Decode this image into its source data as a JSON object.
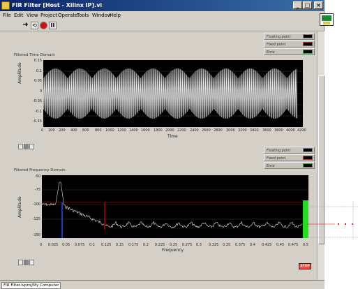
{
  "window": {
    "title": "FIR Filter [Host - Xilinx IP].vi"
  },
  "menu": [
    "File",
    "Edit",
    "View",
    "Project",
    "Operate",
    "Tools",
    "Window",
    "Help"
  ],
  "legend": [
    "Floating point",
    "Fixed point",
    "Error"
  ],
  "time_graph": {
    "label": "Filtered Time Domain",
    "xlabel": "Time",
    "ylabel": "Amplitude",
    "y_ticks": [
      "0.15",
      "0.1",
      "0.05",
      "0",
      "-0.05",
      "-0.1",
      "-0.15"
    ],
    "x_ticks": [
      "0",
      "100",
      "200",
      "400",
      "600",
      "800",
      "1000",
      "1200",
      "1400",
      "1600",
      "1800",
      "2000",
      "2200",
      "2400",
      "2600",
      "2800",
      "3000",
      "3200",
      "3400",
      "3600",
      "3800",
      "4000",
      "4200"
    ]
  },
  "freq_graph": {
    "label": "Filtered Frequency Domain",
    "xlabel": "Frequency",
    "ylabel": "Amplitude",
    "y_ticks": [
      "-50",
      "-75",
      "-100",
      "-125",
      "-150"
    ],
    "x_ticks": [
      "0",
      "0.025",
      "0.05",
      "0.075",
      "0.1",
      "0.125",
      "0.15",
      "0.175",
      "0.2",
      "0.225",
      "0.25",
      "0.275",
      "0.3",
      "0.325",
      "0.35",
      "0.375",
      "0.4",
      "0.425",
      "0.45",
      "0.475",
      "0.5"
    ]
  },
  "stop_label": "STOP",
  "status_text": "FIR Filter.lvproj/My Computer",
  "colors": {
    "panel": "#d4d0c8",
    "plot": "#000000",
    "blue_cursor": "#1e50ff",
    "red_cursor": "#e00000",
    "green_band": "#22dd22"
  }
}
